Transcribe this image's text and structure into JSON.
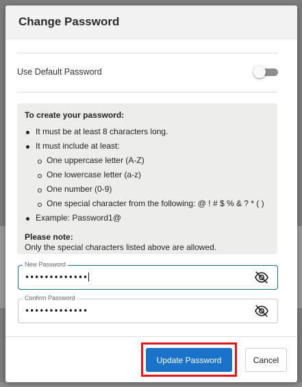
{
  "modal": {
    "title": "Change Password",
    "toggle_label": "Use Default Password",
    "toggle_on": false
  },
  "rules": {
    "heading": "To create your password:",
    "items": [
      "It must be at least 8 characters long.",
      "It must include at least:"
    ],
    "subitems": [
      "One uppercase letter (A-Z)",
      "One lowercase letter (a-z)",
      "One number (0-9)",
      "One special character from the following: @ ! # $ % & ? * ( )"
    ],
    "example": "Example: Password1@",
    "note_heading": "Please note:",
    "note_text": "Only the special characters listed above are allowed."
  },
  "fields": {
    "new_password": {
      "label": "New Password",
      "value": "•••••••••••••"
    },
    "confirm_password": {
      "label": "Confirm Password",
      "value": "•••••••••••••"
    }
  },
  "buttons": {
    "update": "Update Password",
    "cancel": "Cancel"
  },
  "colors": {
    "primary": "#1a73c9",
    "highlight": "#e0161b",
    "active_border": "#1f6f8b"
  },
  "icons": {
    "visibility": "eye-off-icon"
  }
}
